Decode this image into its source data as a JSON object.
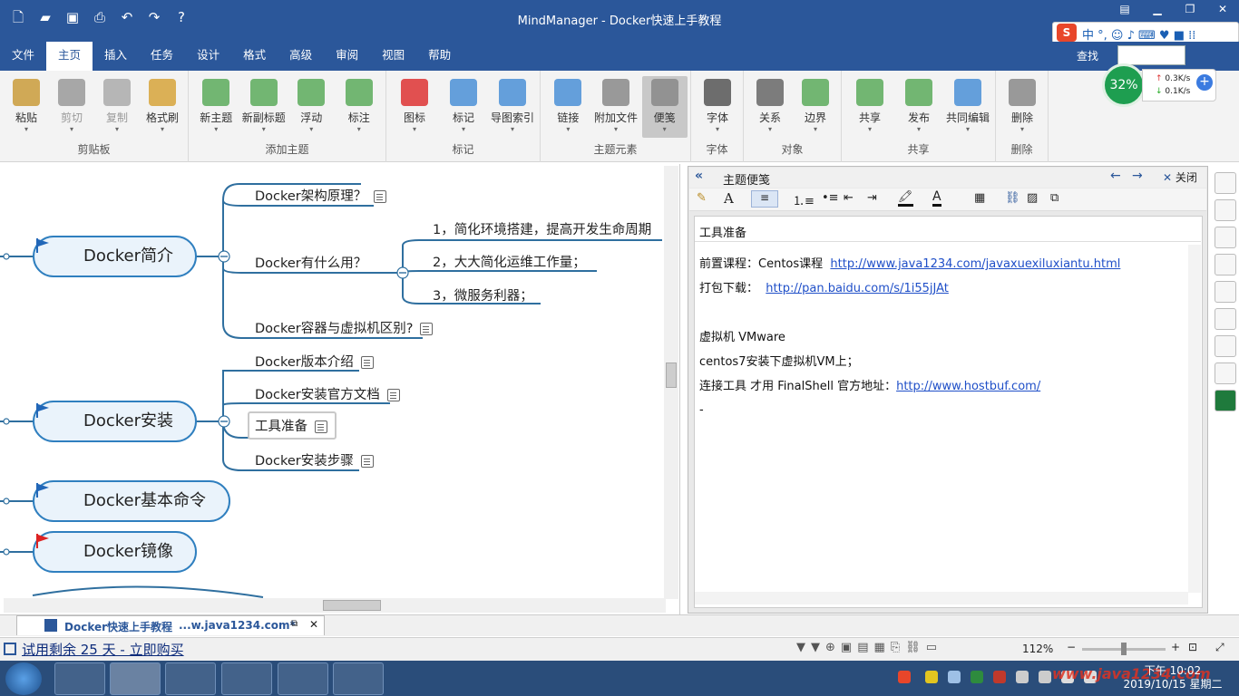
{
  "app": {
    "title": "MindManager - Docker快速上手教程",
    "search_label": "查找"
  },
  "menu_tabs": [
    "文件",
    "主页",
    "插入",
    "任务",
    "设计",
    "格式",
    "高级",
    "审阅",
    "视图",
    "帮助"
  ],
  "ribbon": {
    "groups": [
      {
        "label": "剪贴板",
        "buttons": [
          {
            "label": "粘贴",
            "icon": "paste-icon"
          },
          {
            "label": "剪切",
            "icon": "cut-icon"
          },
          {
            "label": "复制",
            "icon": "copy-icon"
          },
          {
            "label": "格式刷",
            "icon": "format-painter-icon"
          }
        ]
      },
      {
        "label": "添加主题",
        "buttons": [
          {
            "label": "新主题",
            "icon": "new-topic-icon"
          },
          {
            "label": "新副标题",
            "icon": "new-subtopic-icon"
          },
          {
            "label": "浮动",
            "icon": "floating-icon"
          },
          {
            "label": "标注",
            "icon": "callout-icon"
          }
        ]
      },
      {
        "label": "标记",
        "buttons": [
          {
            "label": "图标",
            "icon": "icon-marker-icon"
          },
          {
            "label": "标记",
            "icon": "tag-icon"
          },
          {
            "label": "导图索引",
            "icon": "map-index-icon"
          }
        ]
      },
      {
        "label": "主题元素",
        "buttons": [
          {
            "label": "链接",
            "icon": "link-icon"
          },
          {
            "label": "附加文件",
            "icon": "attachment-icon"
          },
          {
            "label": "便笺",
            "icon": "notes-icon"
          }
        ]
      },
      {
        "label": "字体",
        "buttons": [
          {
            "label": "字体",
            "icon": "font-icon"
          }
        ]
      },
      {
        "label": "对象",
        "buttons": [
          {
            "label": "关系",
            "icon": "relationship-icon"
          },
          {
            "label": "边界",
            "icon": "boundary-icon"
          }
        ]
      },
      {
        "label": "共享",
        "buttons": [
          {
            "label": "共享",
            "icon": "share-icon"
          },
          {
            "label": "发布",
            "icon": "publish-icon"
          },
          {
            "label": "共同编辑",
            "icon": "coedit-icon"
          }
        ]
      },
      {
        "label": "删除",
        "buttons": [
          {
            "label": "删除",
            "icon": "delete-icon"
          }
        ]
      }
    ]
  },
  "net_meter": {
    "percent": "32%",
    "up": "0.3K/s",
    "down": "0.1K/s"
  },
  "mindmap": {
    "main_topics": [
      "Docker简介",
      "Docker安装",
      "Docker基本命令",
      "Docker镜像"
    ],
    "intro_children": [
      "Docker架构原理？",
      "Docker有什么用？",
      "Docker容器与虚拟机区别?"
    ],
    "use_children": [
      "1，简化环境搭建，提高开发生命周期",
      "2，大大简化运维工作量；",
      "3，微服务利器；"
    ],
    "install_children": [
      "Docker版本介绍",
      "Docker安装官方文档",
      "工具准备",
      "Docker安装步骤"
    ]
  },
  "notes": {
    "panel_title": "主题便笺",
    "close_label": "关闭",
    "heading": "工具准备",
    "line1_prefix": "前置课程：Centos课程",
    "line1_link": "http://www.java1234.com/javaxuexiluxiantu.html",
    "line2_prefix": "打包下载：",
    "line2_link": "http://pan.baidu.com/s/1i55jJAt",
    "line3": "虚拟机 VMware",
    "line4": "centos7安装下虚拟机VM上；",
    "line5_prefix": "连接工具 才用 FinalShell  官方地址：",
    "line5_link": "http://www.hostbuf.com/",
    "line6": "-"
  },
  "doc_tab": {
    "name": "Docker快速上手教程",
    "path": "...w.java1234.com*"
  },
  "status": {
    "trial": "试用剩余 25 天 - 立即购买",
    "zoom": "112%"
  },
  "taskbar": {
    "time": "下午 10:02",
    "date": "2019/10/15 星期二",
    "watermark": "www.java1234.com"
  }
}
